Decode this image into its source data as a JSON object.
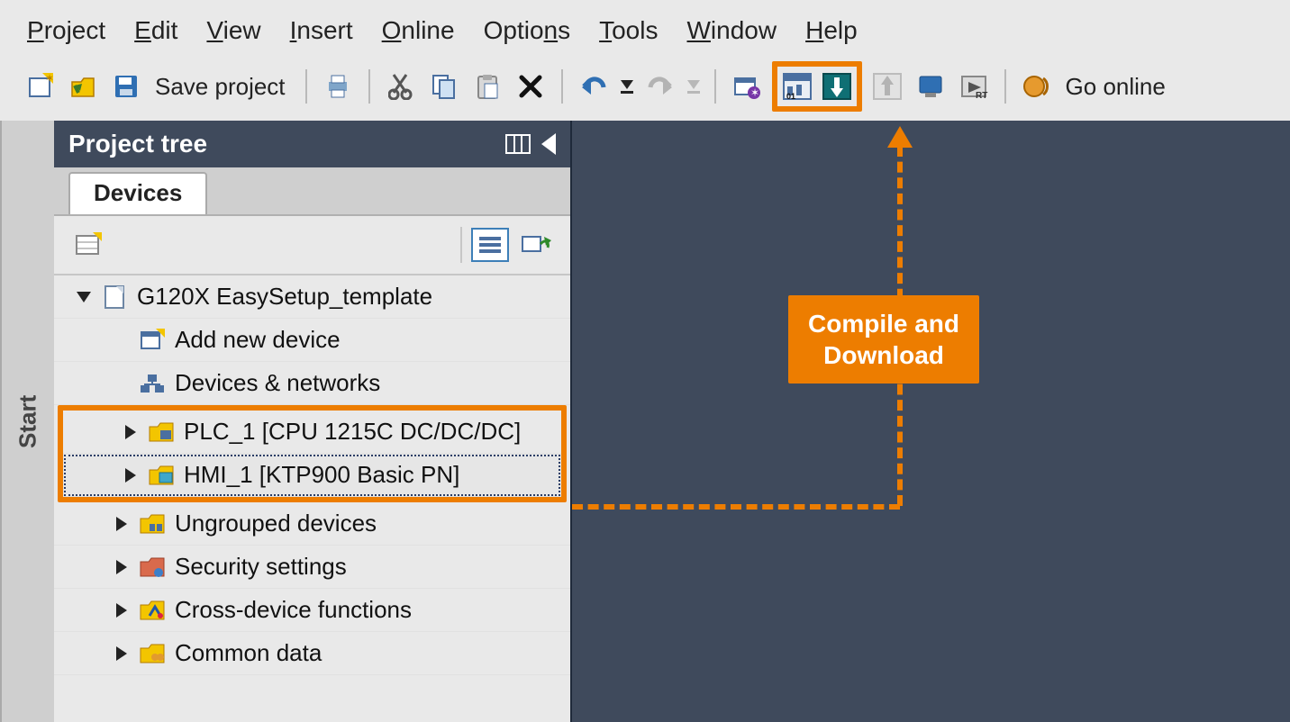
{
  "menu": {
    "project": "Project",
    "edit": "Edit",
    "view": "View",
    "insert": "Insert",
    "online": "Online",
    "options": "Options",
    "tools": "Tools",
    "window": "Window",
    "help": "Help"
  },
  "toolbar": {
    "save_project_label": "Save project",
    "go_online_label": "Go online"
  },
  "panel": {
    "title": "Project tree",
    "tab_devices": "Devices"
  },
  "tree": {
    "project_name": "G120X EasySetup_template",
    "add_device": "Add new device",
    "devices_networks": "Devices & networks",
    "plc": "PLC_1 [CPU 1215C DC/DC/DC]",
    "hmi": "HMI_1 [KTP900 Basic PN]",
    "ungrouped": "Ungrouped devices",
    "security": "Security settings",
    "cross_device": "Cross-device functions",
    "common_data": "Common data"
  },
  "start_rail": "Start",
  "annotation": {
    "text": "Compile and\nDownload"
  },
  "colors": {
    "accent": "#ed7d00",
    "panel_header": "#3f4a5c"
  }
}
